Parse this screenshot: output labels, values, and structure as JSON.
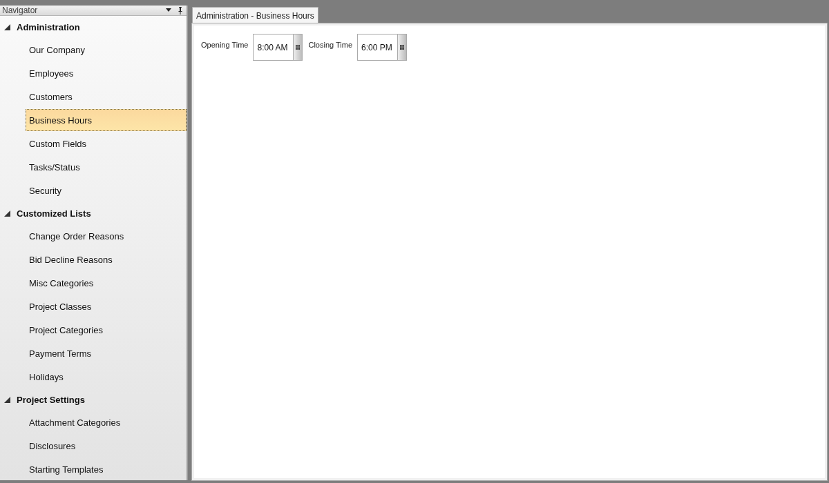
{
  "navigator": {
    "title": "Navigator",
    "groups": [
      {
        "label": "Administration",
        "expanded": true,
        "items": [
          {
            "label": "Our Company",
            "selected": false
          },
          {
            "label": "Employees",
            "selected": false
          },
          {
            "label": "Customers",
            "selected": false
          },
          {
            "label": "Business Hours",
            "selected": true
          },
          {
            "label": "Custom Fields",
            "selected": false
          },
          {
            "label": "Tasks/Status",
            "selected": false
          },
          {
            "label": "Security",
            "selected": false
          }
        ]
      },
      {
        "label": "Customized Lists",
        "expanded": true,
        "items": [
          {
            "label": "Change Order Reasons",
            "selected": false
          },
          {
            "label": "Bid Decline Reasons",
            "selected": false
          },
          {
            "label": "Misc Categories",
            "selected": false
          },
          {
            "label": "Project Classes",
            "selected": false
          },
          {
            "label": "Project Categories",
            "selected": false
          },
          {
            "label": "Payment Terms",
            "selected": false
          },
          {
            "label": "Holidays",
            "selected": false
          }
        ]
      },
      {
        "label": "Project Settings",
        "expanded": true,
        "items": [
          {
            "label": "Attachment Categories",
            "selected": false
          },
          {
            "label": "Disclosures",
            "selected": false
          },
          {
            "label": "Starting Templates",
            "selected": false
          }
        ]
      }
    ]
  },
  "tabs": [
    {
      "label": "Administration - Business Hours",
      "selected": true
    }
  ],
  "fields": [
    {
      "label": "Opening Time",
      "value": "8:00 AM"
    },
    {
      "label": "Closing Time",
      "value": "6:00 PM"
    }
  ]
}
